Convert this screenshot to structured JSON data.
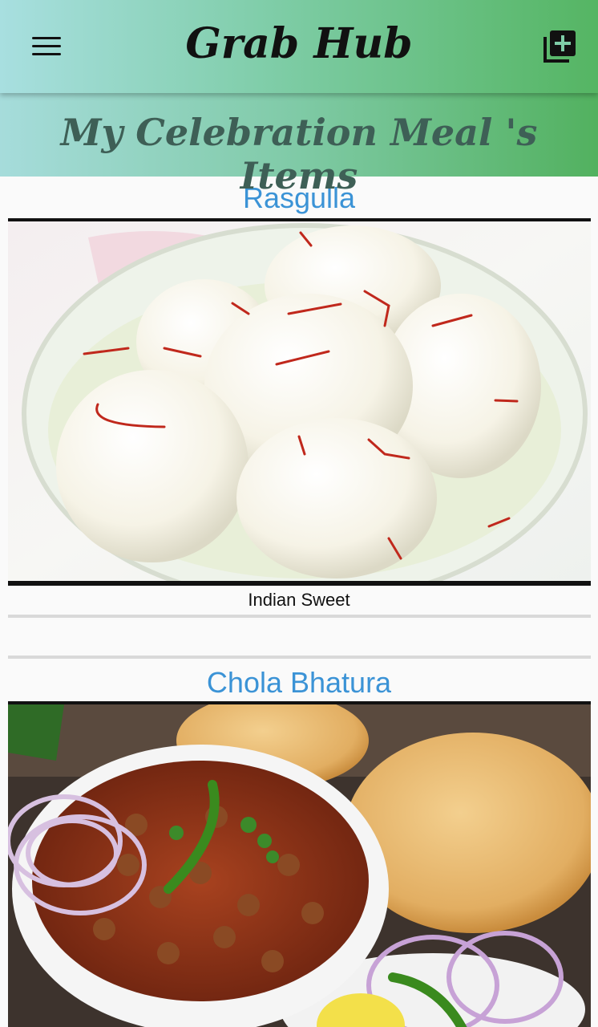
{
  "app": {
    "title": "Grab Hub"
  },
  "header": {
    "menu_icon": "hamburger-menu-icon",
    "add_icon": "library-add-icon"
  },
  "subtitle": "My Celebration Meal 's Items",
  "items": [
    {
      "name": "Rasgulla",
      "description": "Indian Sweet"
    },
    {
      "name": "Chola Bhatura",
      "description": ""
    }
  ],
  "colors": {
    "gradient_start": "#a8dfe0",
    "gradient_end": "#55b563",
    "item_title": "#3b93d6",
    "subtitle_text": "#3e5f56"
  }
}
